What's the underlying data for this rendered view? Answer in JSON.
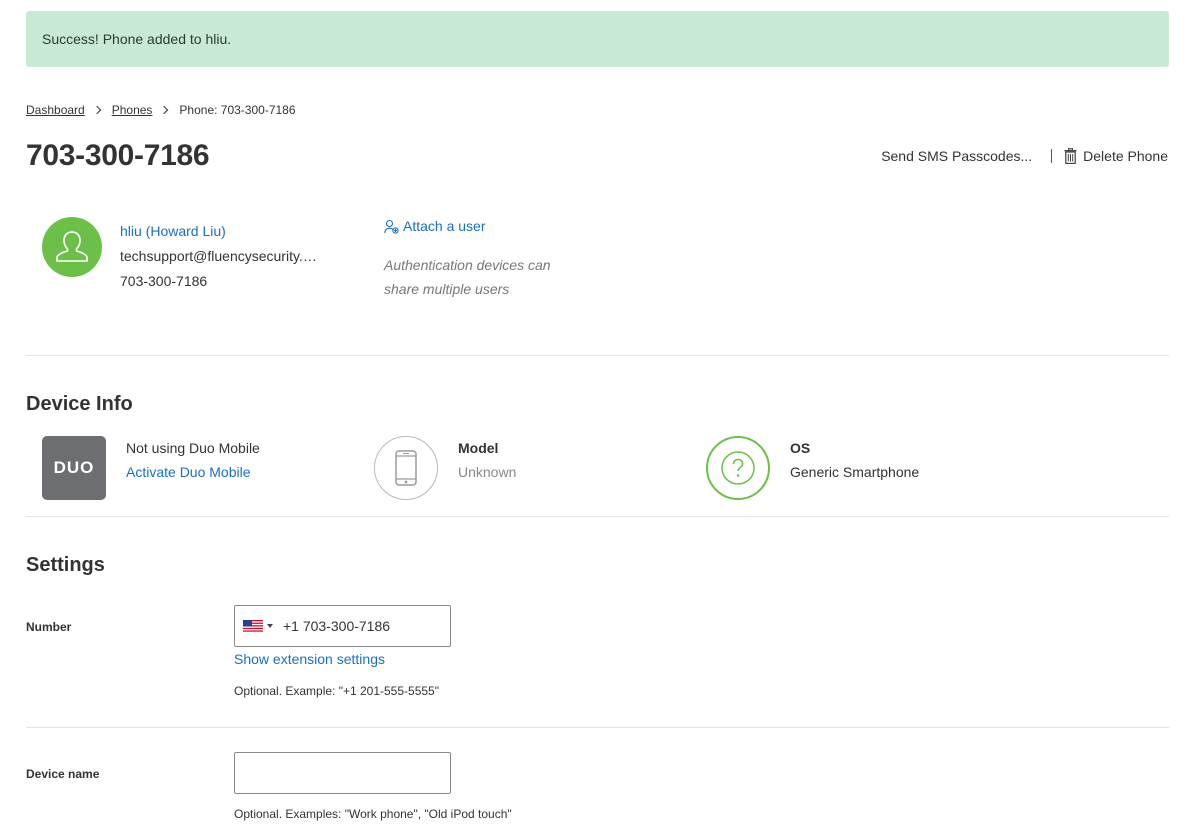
{
  "alert": {
    "message": "Success! Phone added to hliu."
  },
  "breadcrumb": {
    "items": [
      "Dashboard",
      "Phones"
    ],
    "current": "Phone: 703-300-7186"
  },
  "page": {
    "title": "703-300-7186"
  },
  "actions": {
    "send_sms": "Send SMS Passcodes...",
    "delete_phone": "Delete Phone"
  },
  "user": {
    "name": "hliu (Howard Liu)",
    "email": "techsupport@fluencysecurity.com",
    "phone": "703-300-7186",
    "attach_label": "Attach a user",
    "attach_help": "Authentication devices can share multiple users"
  },
  "device_info": {
    "title": "Device Info",
    "app_status": "Not using Duo Mobile",
    "activate_label": "Activate Duo Mobile",
    "model_label": "Model",
    "model_value": "Unknown",
    "os_label": "OS",
    "os_value": "Generic Smartphone",
    "logo_text": "DUO"
  },
  "settings": {
    "title": "Settings",
    "number_label": "Number",
    "number_value": "+1 703-300-7186",
    "extension_link": "Show extension settings",
    "number_help": "Optional. Example: \"+1 201-555-5555\"",
    "device_name_label": "Device name",
    "device_name_value": "",
    "device_name_help": "Optional. Examples: \"Work phone\", \"Old iPod touch\""
  },
  "colors": {
    "success_bg": "#c8ead3",
    "link": "#1a6fc4",
    "accent_green": "#6cc04a",
    "logo_gray": "#6d6e71"
  }
}
